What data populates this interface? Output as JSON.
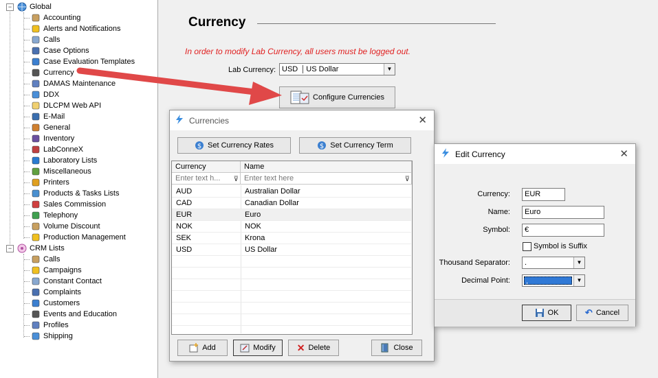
{
  "tree": {
    "global_label": "Global",
    "global_items": [
      {
        "label": "Accounting",
        "icon": "accounting-icon"
      },
      {
        "label": "Alerts and Notifications",
        "icon": "bell-icon"
      },
      {
        "label": "Calls",
        "icon": "phone-icon"
      },
      {
        "label": "Case Options",
        "icon": "case-options-icon"
      },
      {
        "label": "Case Evaluation Templates",
        "icon": "star-icon"
      },
      {
        "label": "Currency",
        "icon": "currency-icon"
      },
      {
        "label": "DAMAS Maintenance",
        "icon": "damas-icon"
      },
      {
        "label": "DDX",
        "icon": "ddx-icon"
      },
      {
        "label": "DLCPM Web API",
        "icon": "web-api-icon"
      },
      {
        "label": "E-Mail",
        "icon": "email-icon"
      },
      {
        "label": "General",
        "icon": "general-icon"
      },
      {
        "label": "Inventory",
        "icon": "inventory-icon"
      },
      {
        "label": "LabConneX",
        "icon": "labconnex-icon"
      },
      {
        "label": "Laboratory Lists",
        "icon": "lists-icon"
      },
      {
        "label": "Miscellaneous",
        "icon": "misc-icon"
      },
      {
        "label": "Printers",
        "icon": "printer-icon"
      },
      {
        "label": "Products & Tasks Lists",
        "icon": "products-icon"
      },
      {
        "label": "Sales Commission",
        "icon": "commission-icon"
      },
      {
        "label": "Telephony",
        "icon": "telephony-icon"
      },
      {
        "label": "Volume Discount",
        "icon": "percent-icon"
      },
      {
        "label": "Production Management",
        "icon": "production-icon"
      }
    ],
    "crm_label": "CRM Lists",
    "crm_items": [
      {
        "label": "Calls",
        "icon": "phone-icon"
      },
      {
        "label": "Campaigns",
        "icon": "campaign-icon"
      },
      {
        "label": "Constant Contact",
        "icon": "envelope-icon"
      },
      {
        "label": "Complaints",
        "icon": "complaint-icon"
      },
      {
        "label": "Customers",
        "icon": "customers-icon"
      },
      {
        "label": "Events and Education",
        "icon": "events-icon"
      },
      {
        "label": "Profiles",
        "icon": "profiles-icon"
      },
      {
        "label": "Shipping",
        "icon": "shipping-icon"
      }
    ]
  },
  "main": {
    "title": "Currency",
    "warning": "In order to modify Lab Currency, all users must be logged out.",
    "lab_currency_label": "Lab Currency:",
    "lab_currency_code": "USD",
    "lab_currency_name": "US Dollar",
    "configure_label": "Configure Currencies"
  },
  "currencies_window": {
    "title": "Currencies",
    "set_rates_label": "Set Currency Rates",
    "set_term_label": "Set Currency Term",
    "columns": [
      "Currency",
      "Name"
    ],
    "filter_placeholders": [
      "Enter text h...",
      "Enter text here"
    ],
    "rows": [
      {
        "code": "AUD",
        "name": "Australian Dollar"
      },
      {
        "code": "CAD",
        "name": "Canadian Dollar"
      },
      {
        "code": "EUR",
        "name": "Euro"
      },
      {
        "code": "NOK",
        "name": "NOK"
      },
      {
        "code": "SEK",
        "name": "Krona"
      },
      {
        "code": "USD",
        "name": "US Dollar"
      }
    ],
    "add_label": "Add",
    "modify_label": "Modify",
    "delete_label": "Delete",
    "close_label": "Close"
  },
  "edit_window": {
    "title": "Edit Currency",
    "currency_label": "Currency:",
    "currency_value": "EUR",
    "name_label": "Name:",
    "name_value": "Euro",
    "symbol_label": "Symbol:",
    "symbol_value": "€",
    "suffix_label": "Symbol is Suffix",
    "thousand_label": "Thousand Separator:",
    "thousand_value": ".",
    "decimal_label": "Decimal Point:",
    "decimal_value": ",",
    "ok_label": "OK",
    "cancel_label": "Cancel"
  },
  "colors": {
    "warning": "#e02020",
    "arrow": "#e04848",
    "selection": "#3079d6"
  }
}
